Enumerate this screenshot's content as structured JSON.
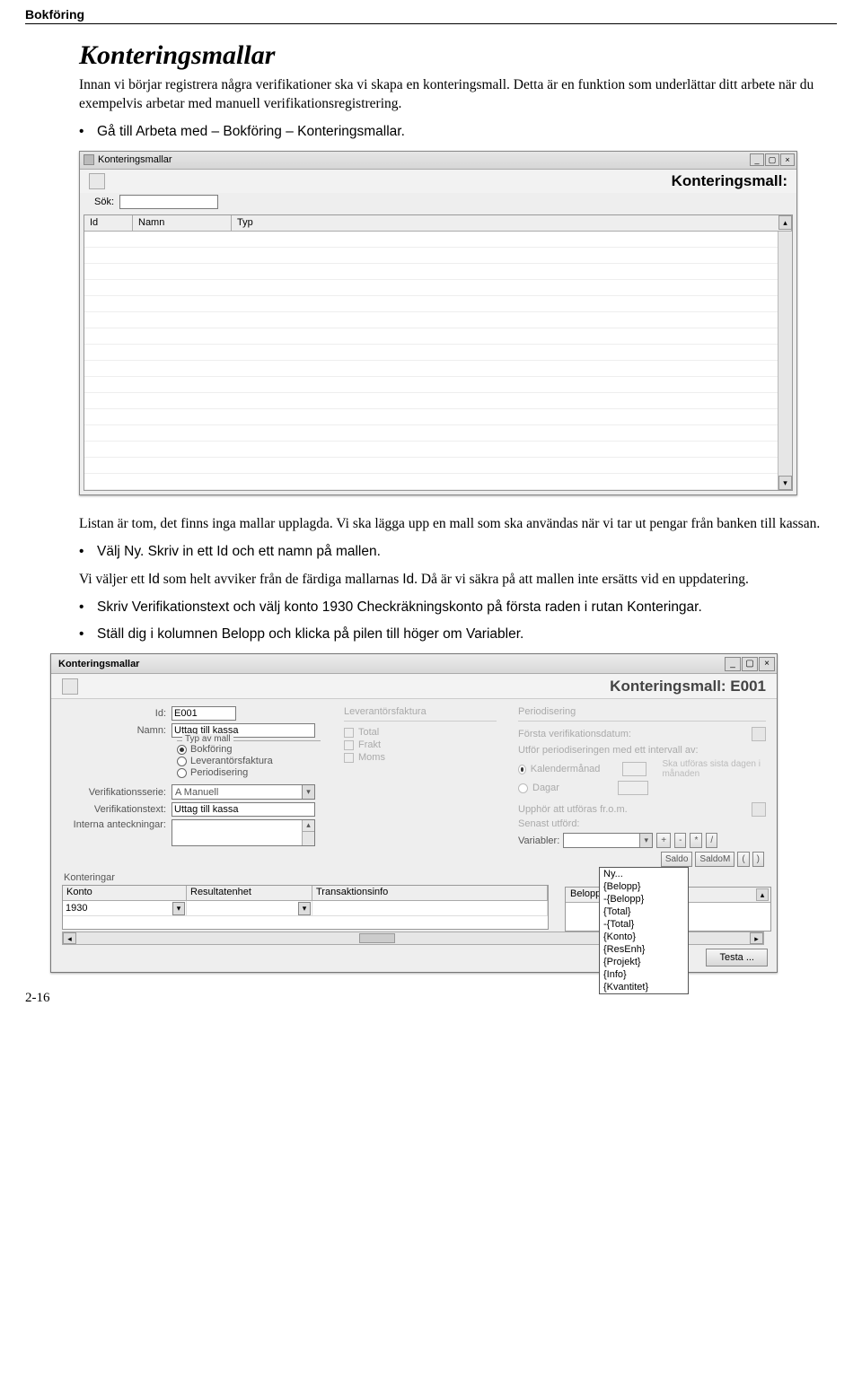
{
  "header": "Bokföring",
  "title": "Konteringsmallar",
  "intro": "Innan vi börjar registrera några verifikationer ska vi skapa en konteringsmall. Detta är en funktion som underlättar ditt arbete när du exempelvis arbetar med manuell verifikationsregistrering.",
  "bullet1": "Gå till Arbeta med – Bokföring – Konteringsmallar.",
  "paragraph2": "Listan är tom, det finns inga mallar upplagda. Vi ska lägga upp en mall som ska användas när vi tar ut pengar från banken till kassan.",
  "bullet2_prefix": "Välj ",
  "bullet2_ny": "Ny",
  "bullet2_mid": ". Skriv in ett ",
  "bullet2_id": "Id",
  "bullet2_suffix": " och ett namn på mallen.",
  "paragraph3_p1": "Vi väljer ett ",
  "paragraph3_id1": "Id",
  "paragraph3_p2": " som helt avviker från de färdiga mallarnas ",
  "paragraph3_id2": "Id",
  "paragraph3_p3": ". Då är vi säkra på att mallen inte ersätts vid en uppdatering.",
  "bullet3_p1": "Skriv ",
  "bullet3_vt": "Verifikationstext",
  "bullet3_p2": " och välj konto 1930 Checkräkningskonto på första raden i rutan ",
  "bullet3_kont": "Konteringar",
  "bullet3_p3": ".",
  "bullet4_p1": "Ställ dig i kolumnen ",
  "bullet4_b": "Belopp",
  "bullet4_p2": " och klicka på pilen till höger om ",
  "bullet4_v": "Variabler",
  "bullet4_p3": ".",
  "win1": {
    "title": "Konteringsmallar",
    "bigtitle": "Konteringsmall:",
    "sok": "Sök:",
    "cols": {
      "id": "Id",
      "namn": "Namn",
      "typ": "Typ"
    }
  },
  "win2": {
    "title": "Konteringsmallar",
    "bigtitle": "Konteringsmall: E001",
    "labels": {
      "id": "Id:",
      "namn": "Namn:",
      "typavmall": "Typ av mall",
      "bokforing": "Bokföring",
      "leverantorsfaktura": "Leverantörsfaktura",
      "periodisering": "Periodisering",
      "verifserie": "Verifikationsserie:",
      "veriftext": "Verifikationstext:",
      "interna": "Interna anteckningar:",
      "levfakt": "Leverantörsfaktura",
      "total": "Total",
      "frakt": "Frakt",
      "moms": "Moms",
      "period_title": "Periodisering",
      "forsta": "Första verifikationsdatum:",
      "utfor": "Utför periodiseringen med ett intervall av:",
      "kalender": "Kalendermånad",
      "dagar": "Dagar",
      "skautf": "Ska utföras sista dagen i månaden",
      "upphor": "Upphör att utföras fr.o.m.",
      "senast": "Senast utförd:",
      "variabler": "Variabler:",
      "btn_plus": "+",
      "btn_minus": "-",
      "btn_mul": "*",
      "btn_div": "/",
      "btn_saldo": "Saldo",
      "btn_saldom": "SaldoM",
      "btn_lp": "(",
      "btn_rp": ")",
      "konteringar": "Konteringar",
      "konto": "Konto",
      "resenhet": "Resultatenhet",
      "transinfo": "Transaktionsinfo",
      "belopp": "Belopp",
      "testa": "Testa ..."
    },
    "values": {
      "id": "E001",
      "namn": "Uttag till kassa",
      "verifserie": "A Manuell",
      "veriftext": "Uttag till kassa",
      "konto1": "1930"
    },
    "var_options": [
      "Ny...",
      "{Belopp}",
      "-{Belopp}",
      "{Total}",
      "-{Total}",
      "{Konto}",
      "{ResEnh}",
      "{Projekt}",
      "{Info}",
      "{Kvantitet}"
    ]
  },
  "page_num": "2-16"
}
